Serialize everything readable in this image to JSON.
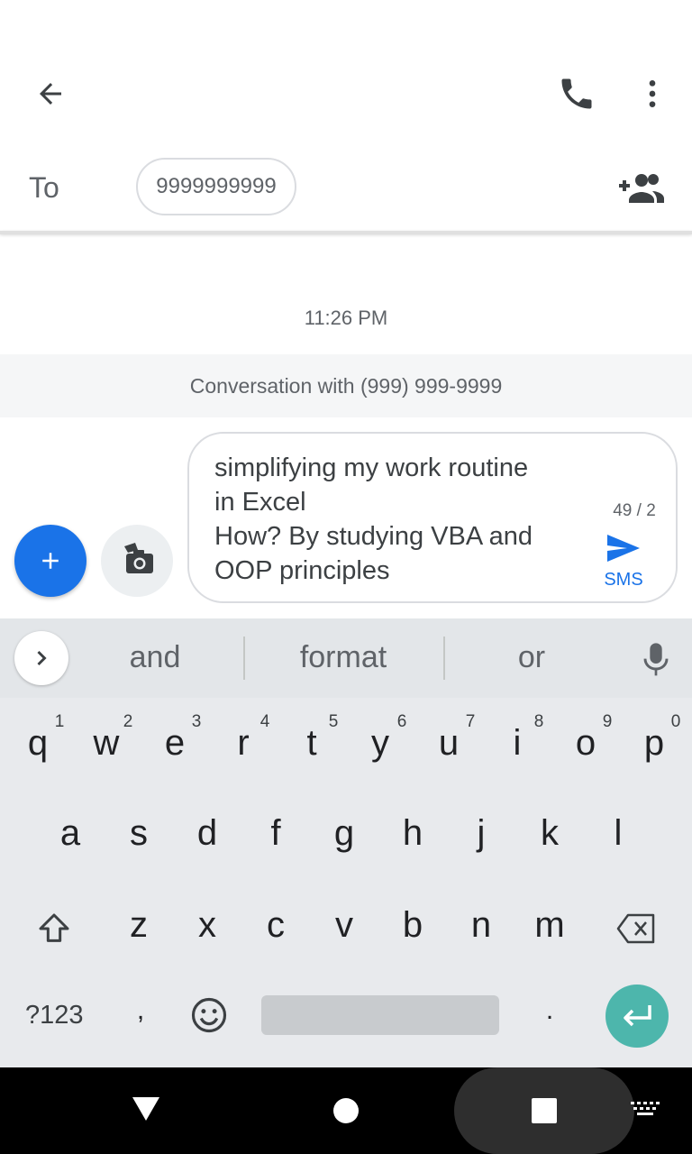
{
  "header": {
    "back_icon": "arrow-back-icon",
    "call_icon": "phone-icon",
    "more_icon": "more-vert-icon"
  },
  "recipient": {
    "to_label": "To",
    "chip_text": "9999999999",
    "add_people_icon": "group-add-icon"
  },
  "conversation": {
    "timestamp": "11:26 PM",
    "banner": "Conversation with (999) 999-9999"
  },
  "compose": {
    "text": "simplifying my work routine\nin Excel\nHow? By studying VBA and\nOOP principles",
    "counter": "49 / 2",
    "send_label": "SMS",
    "send_icon": "send-icon",
    "add_icon": "plus-icon",
    "camera_icon": "camera-icon",
    "accent_color": "#1a73e8"
  },
  "keyboard": {
    "suggestions": [
      "and",
      "format",
      "or"
    ],
    "row1": [
      "q",
      "w",
      "e",
      "r",
      "t",
      "y",
      "u",
      "i",
      "o",
      "p"
    ],
    "row1_nums": [
      "1",
      "2",
      "3",
      "4",
      "5",
      "6",
      "7",
      "8",
      "9",
      "0"
    ],
    "row2": [
      "a",
      "s",
      "d",
      "f",
      "g",
      "h",
      "j",
      "k",
      "l"
    ],
    "row3": [
      "z",
      "x",
      "c",
      "v",
      "b",
      "n",
      "m"
    ],
    "symbols_label": "?123",
    "comma": ",",
    "period": ".",
    "enter_color": "#4db6ac"
  },
  "navbar": {
    "back_icon": "nav-back-icon",
    "home_icon": "nav-home-icon",
    "recents_icon": "nav-recents-icon",
    "keyboard_icon": "keyboard-icon"
  }
}
